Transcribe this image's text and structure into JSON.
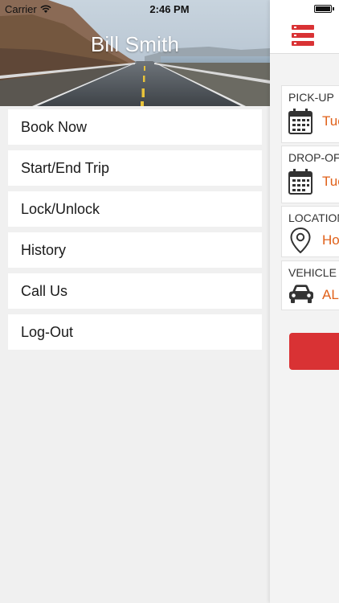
{
  "status_bar": {
    "carrier": "Carrier",
    "time": "2:46 PM"
  },
  "drawer": {
    "user_name": "Bill Smith",
    "menu": [
      {
        "label": "Book Now"
      },
      {
        "label": "Start/End Trip"
      },
      {
        "label": "Lock/Unlock"
      },
      {
        "label": "History"
      },
      {
        "label": "Call Us"
      },
      {
        "label": "Log-Out"
      }
    ]
  },
  "main": {
    "fields": {
      "pickup": {
        "label": "PICK-UP",
        "value": "Tue",
        "icon": "calendar-icon"
      },
      "dropoff": {
        "label": "DROP-OF",
        "value": "Tue",
        "icon": "calendar-icon"
      },
      "location": {
        "label": "LOCATION",
        "value": "Ho",
        "icon": "map-pin-icon"
      },
      "vehicle": {
        "label": "VEHICLE",
        "value": "AL",
        "icon": "car-icon"
      }
    }
  },
  "colors": {
    "accent_red": "#d93234",
    "value_orange": "#e0611a",
    "menu_bg": "#ffffff",
    "drawer_bg": "#f0f0f0"
  }
}
